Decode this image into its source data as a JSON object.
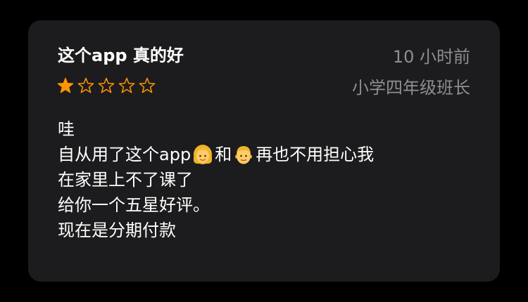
{
  "review": {
    "title": "这个app 真的好",
    "time": "10 小时前",
    "author": "小学四年级班长",
    "rating": 1,
    "rating_max": 5,
    "body": {
      "line1": "哇",
      "line2_a": "自从用了这个app ",
      "line2_b": "和",
      "line2_c": "再也不用担心我",
      "line3": "在家里上不了课了",
      "line4": "给你一个五星好评。",
      "line5": "现在是分期付款"
    },
    "emojis": [
      "woman-emoji",
      "man-emoji"
    ]
  },
  "colors": {
    "star": "#ff9500",
    "meta": "#8e8e93",
    "card": "#1c1c1e"
  }
}
